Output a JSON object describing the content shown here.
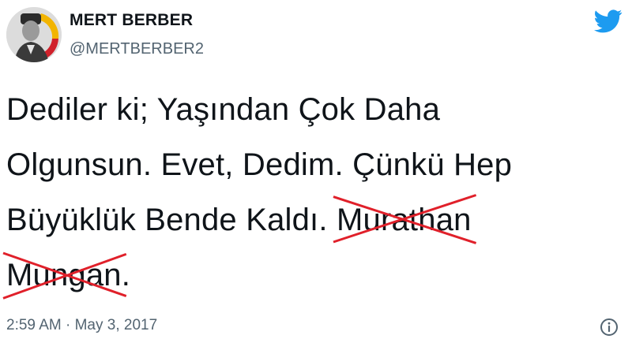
{
  "author": {
    "name": "MERT BERBER",
    "handle": "@MERTBERBER2"
  },
  "tweet": {
    "line1": "Dediler ki; Yaşından Çok Daha",
    "line2": "Olgunsun. Evet, Dedim. Çünkü Hep",
    "line3_prefix": "Büyüklük Bende Kaldı. ",
    "struck_word1": "Murathan",
    "struck_word2": "Mungan",
    "line4_suffix": "."
  },
  "meta": {
    "time": "2:59 AM",
    "separator": " · ",
    "date": "May 3, 2017"
  },
  "colors": {
    "twitter_blue": "#1d9bf0",
    "strike_red": "#e0202a",
    "muted": "#536471"
  },
  "icons": {
    "brand": "twitter-bird-icon",
    "info": "info-icon"
  }
}
